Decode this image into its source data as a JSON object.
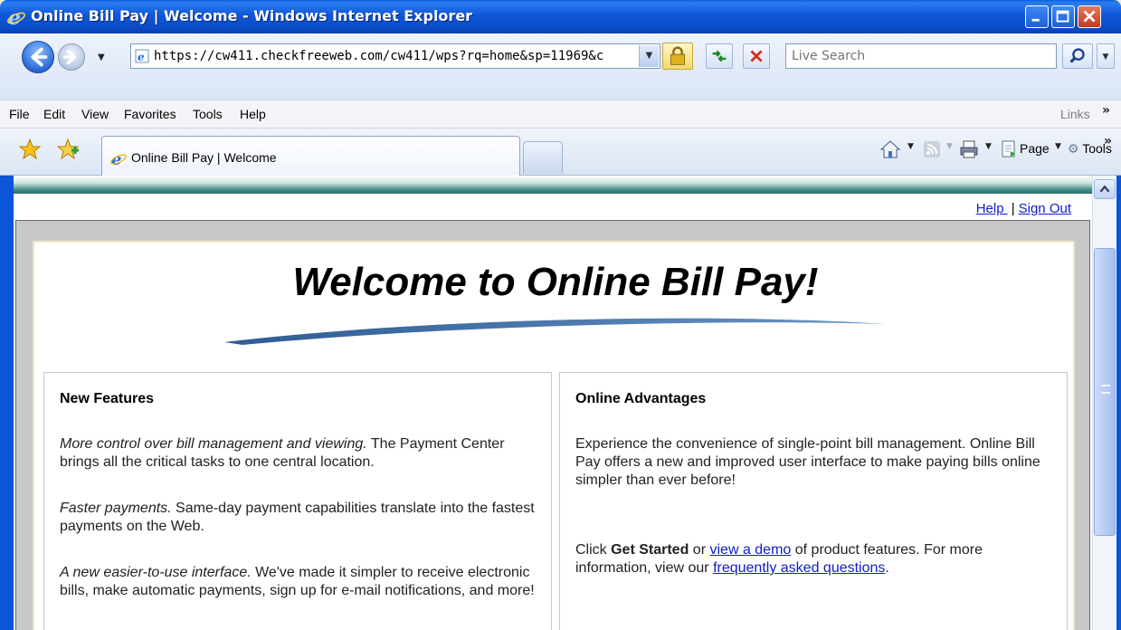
{
  "window": {
    "title": "Online Bill Pay | Welcome - Windows Internet Explorer"
  },
  "address_bar": {
    "url": "https://cw411.checkfreeweb.com/cw411/wps?rq=home&sp=11969&c"
  },
  "search": {
    "placeholder": "Live Search"
  },
  "menu": {
    "items": [
      "File",
      "Edit",
      "View",
      "Favorites",
      "Tools",
      "Help"
    ],
    "links_label": "Links",
    "chevron": "»"
  },
  "tabs": {
    "active_label": "Online Bill Pay | Welcome"
  },
  "commands": {
    "page_label": "Page",
    "tools_label": "Tools",
    "chevron": "»"
  },
  "page": {
    "help_link": "Help ",
    "separator": "|",
    "signout_link": "Sign Out",
    "welcome_title": "Welcome to Online Bill Pay!",
    "left_panel": {
      "heading": "New Features",
      "feature1_italic": "More control over bill management and viewing.",
      "feature1_text": " The Payment Center brings all the critical tasks to one central location.",
      "feature2_italic": "Faster payments.",
      "feature2_text": " Same-day payment capabilities translate into the fastest payments on the Web.",
      "feature3_italic": "A new easier-to-use interface.",
      "feature3_text": " We've made it simpler to receive electronic bills, make automatic payments, sign up for e-mail notifications, and more!"
    },
    "right_panel": {
      "heading": "Online Advantages",
      "intro": "Experience the convenience of single-point bill management. Online Bill Pay offers a new and improved user interface to make paying bills online simpler than ever before!",
      "click_prefix": "Click ",
      "get_started": "Get Started",
      "or_text": " or ",
      "demo_link": "view a demo",
      "features_text": " of product features. For more information, view our ",
      "faq_link": "frequently asked questions",
      "period": "."
    }
  },
  "colors": {
    "titlebar": "#0a4ac7",
    "link": "#1020c8",
    "teal_band": "#3b8a83",
    "frame_gray": "#c8c8c8",
    "swoosh": "#4a72a8"
  }
}
